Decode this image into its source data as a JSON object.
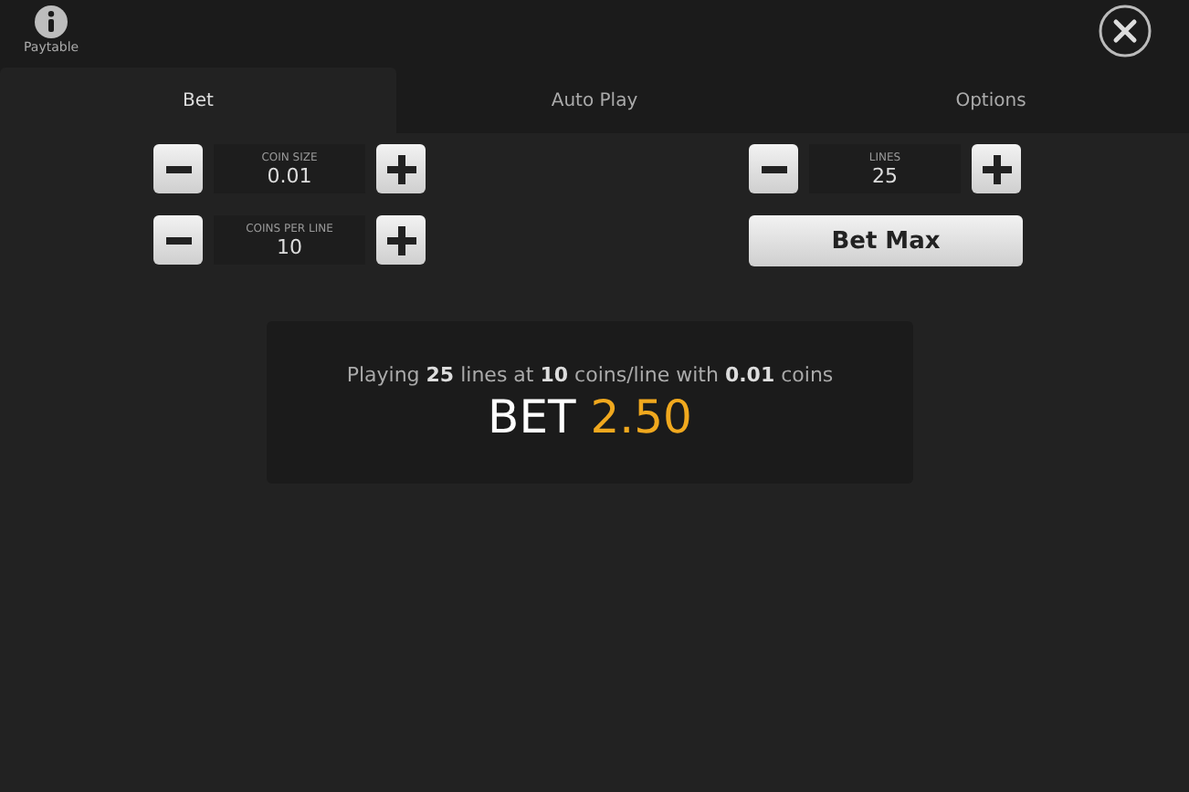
{
  "paytable": {
    "label": "Paytable"
  },
  "tabs": [
    {
      "label": "Bet",
      "selected": true
    },
    {
      "label": "Auto Play",
      "selected": false
    },
    {
      "label": "Options",
      "selected": false
    }
  ],
  "steppers_left": [
    {
      "label": "COIN SIZE",
      "value": "0.01"
    },
    {
      "label": "COINS PER LINE",
      "value": "10"
    }
  ],
  "stepper_right": {
    "label": "LINES",
    "value": "25"
  },
  "bet_max_button": "Bet Max",
  "summary": {
    "text": "Playing **25** lines at **10** coins/line with **0.01** coins",
    "bet_label": "BET",
    "bet_value": "2.50"
  }
}
